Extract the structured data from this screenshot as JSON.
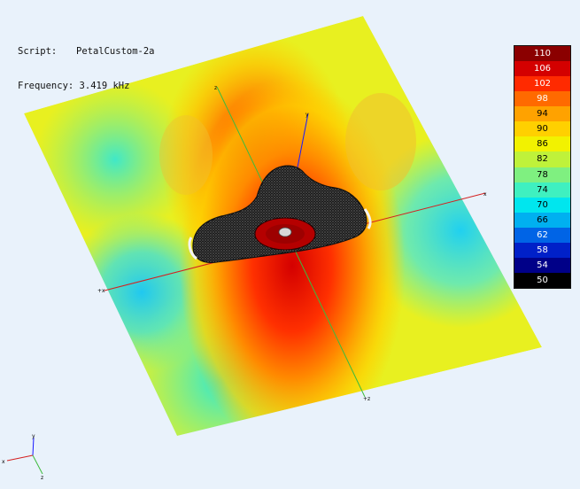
{
  "info": {
    "script_label": "Script:",
    "script_value": "PetalCustom-2a",
    "frequency_label": "Frequency:",
    "frequency_value": "3.419 kHz"
  },
  "legend": {
    "ticks": [
      "110",
      "106",
      "102",
      "98",
      "94",
      "90",
      "86",
      "82",
      "78",
      "74",
      "70",
      "66",
      "62",
      "58",
      "54",
      "50"
    ],
    "colors": [
      "#8b0000",
      "#d40000",
      "#ff2a00",
      "#ff6a00",
      "#ffa200",
      "#ffd000",
      "#f2f200",
      "#bff23a",
      "#7ff080",
      "#3ff0c0",
      "#00e6ee",
      "#00b0f0",
      "#0064e6",
      "#0020c8",
      "#000088",
      "#000000"
    ],
    "text_colors": [
      "#fff",
      "#fff",
      "#fff",
      "#fff",
      "#000",
      "#000",
      "#000",
      "#000",
      "#000",
      "#000",
      "#000",
      "#000",
      "#fff",
      "#fff",
      "#fff",
      "#fff"
    ]
  },
  "axes": {
    "x_color": "#d42020",
    "y_color": "#1a1aff",
    "z_color": "#3dbb3d"
  }
}
